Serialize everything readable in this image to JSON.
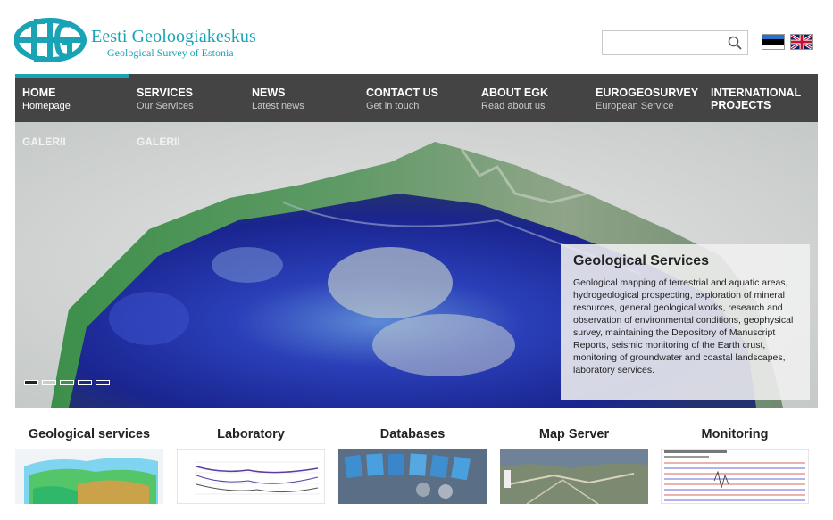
{
  "header": {
    "logo_title": "Eesti Geoloogiakeskus",
    "logo_subtitle": "Geological Survey of Estonia",
    "search_placeholder": "",
    "languages": [
      "et",
      "en"
    ]
  },
  "nav": {
    "items": [
      {
        "label": "HOME",
        "sub": "Homepage",
        "active": true
      },
      {
        "label": "SERVICES",
        "sub": "Our Services"
      },
      {
        "label": "NEWS",
        "sub": "Latest news"
      },
      {
        "label": "CONTACT US",
        "sub": "Get in touch"
      },
      {
        "label": "ABOUT EGK",
        "sub": "Read about us"
      },
      {
        "label": "EUROGEOSURVEY",
        "sub": "European Service"
      },
      {
        "label": "INTERNATIONAL PROJECTS",
        "sub": ""
      }
    ]
  },
  "hero": {
    "galerii": [
      "GALERII",
      "GALERII"
    ],
    "caption_title": "Geological Services",
    "caption_text": "Geological mapping of terrestrial and aquatic areas, hydrogeological prospecting, exploration of mineral resources, general geological works, research and observation of environmental conditions, geophysical survey, maintaining the Depository of Manuscript Reports, seismic monitoring of the Earth crust, monitoring of groundwater and coastal landscapes, laboratory services.",
    "slides": 5,
    "active_slide": 1
  },
  "cards": [
    {
      "title": "Geological services"
    },
    {
      "title": "Laboratory"
    },
    {
      "title": "Databases"
    },
    {
      "title": "Map Server"
    },
    {
      "title": "Monitoring"
    }
  ],
  "colors": {
    "brand": "#1aa3b5",
    "nav_bg": "#444444"
  }
}
